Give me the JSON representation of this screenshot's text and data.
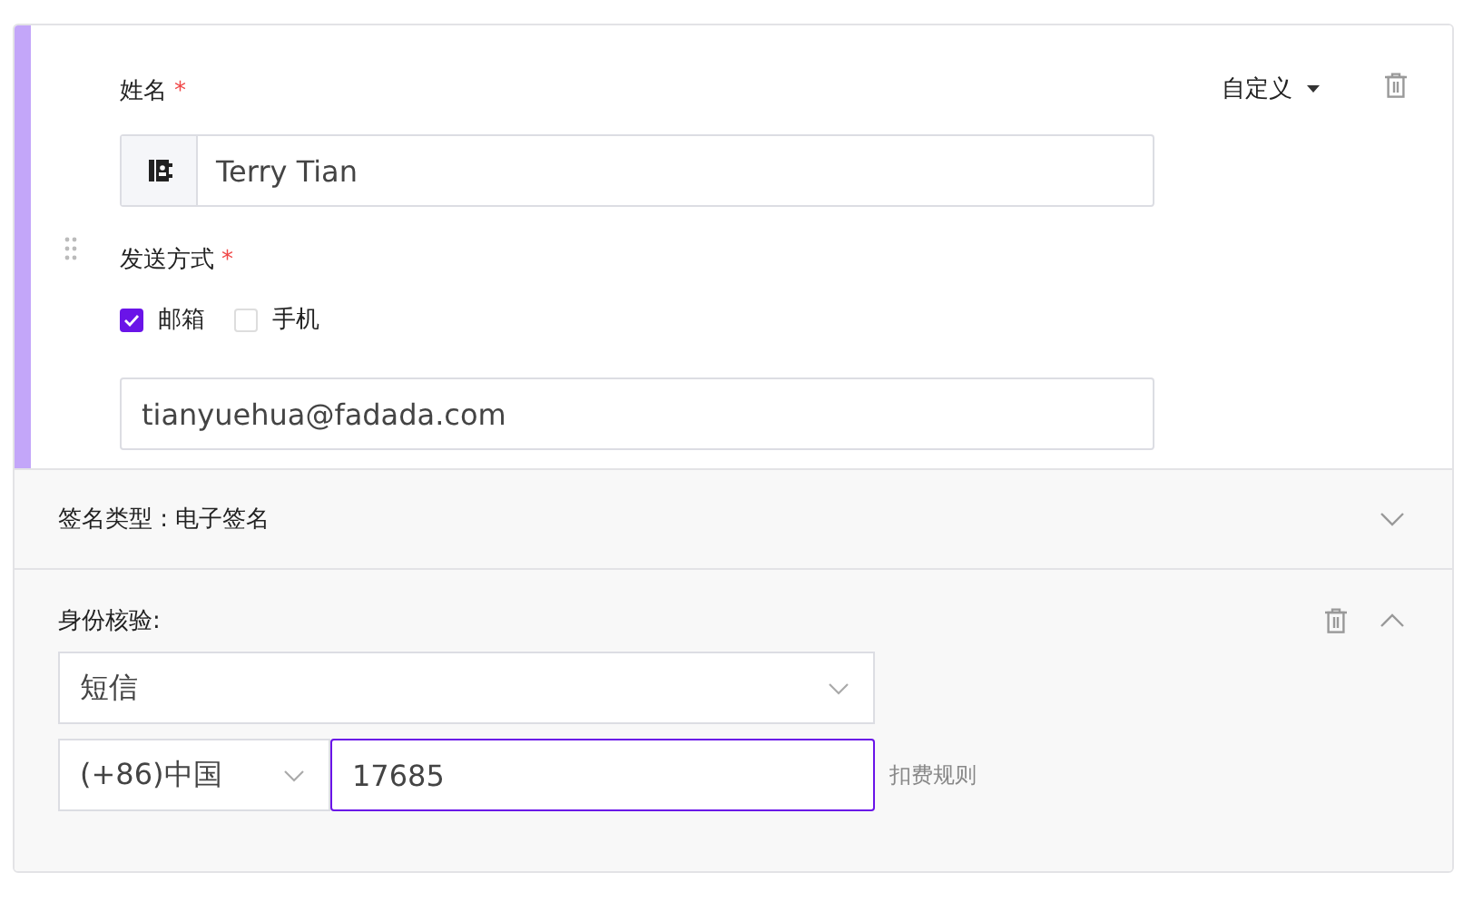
{
  "signer": {
    "name_label": "姓名",
    "name_required": "*",
    "name_value": "Terry Tian",
    "type_menu": "自定义",
    "method_label": "发送方式",
    "method_required": "*",
    "methods": [
      {
        "label": "邮箱",
        "checked": true
      },
      {
        "label": "手机",
        "checked": false
      }
    ],
    "contact_value": "tianyuehua@fadada.com"
  },
  "signature_type": {
    "label": "签名类型 : 电子签名",
    "expanded": false
  },
  "identity": {
    "label": "身份核验:",
    "expanded": true,
    "method": "短信",
    "country": "(+86)中国",
    "phone": "17685",
    "phone_focused": true,
    "link": "扣费规则"
  }
}
